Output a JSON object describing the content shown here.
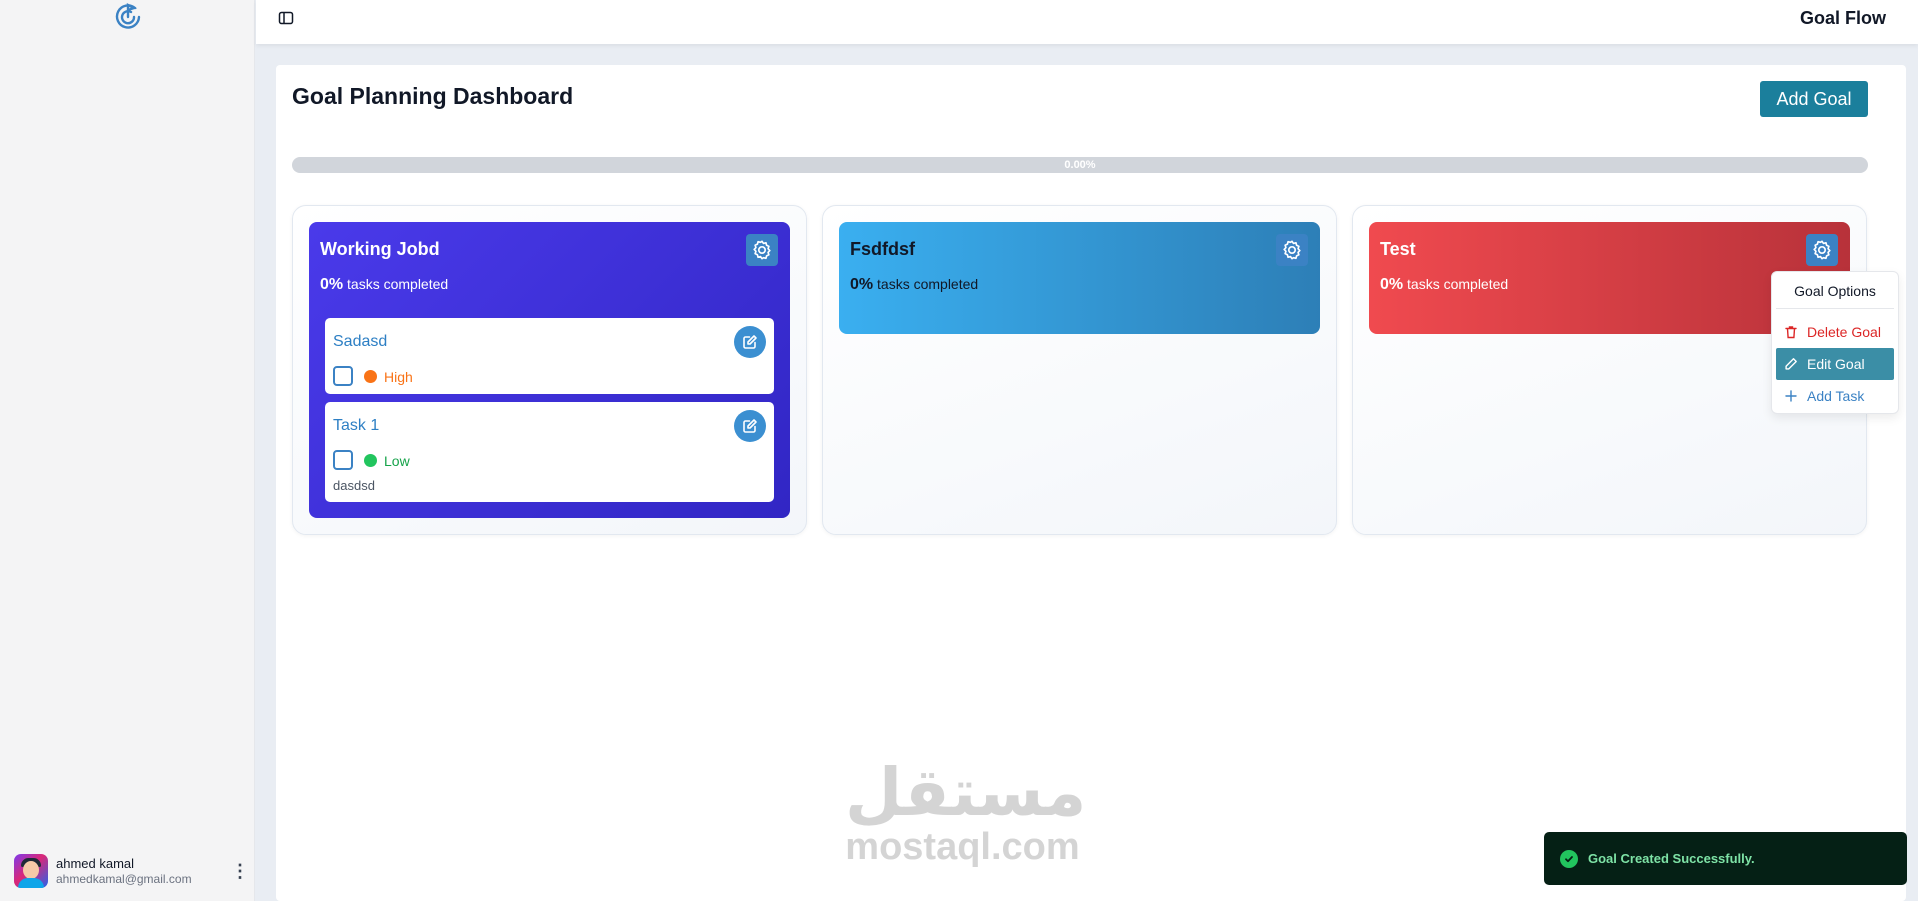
{
  "app": {
    "title": "Goal Flow"
  },
  "sidebar": {
    "user": {
      "name": "ahmed kamal",
      "email": "ahmedkamal@gmail.com"
    }
  },
  "dashboard": {
    "title": "Goal Planning Dashboard",
    "add_goal_label": "Add Goal",
    "progress": 0.0,
    "progress_label": "0.00%"
  },
  "goals": [
    {
      "title": "Working Jobd",
      "percent": "0%",
      "suffix": "tasks completed",
      "tasks": [
        {
          "title": "Sadasd",
          "priority": "High",
          "priority_color": "#f97316",
          "description": ""
        },
        {
          "title": "Task 1",
          "priority": "Low",
          "priority_color": "#22c55e",
          "description": "dasdsd"
        }
      ]
    },
    {
      "title": "Fsdfdsf",
      "percent": "0%",
      "suffix": "tasks completed",
      "tasks": []
    },
    {
      "title": "Test",
      "percent": "0%",
      "suffix": "tasks completed",
      "tasks": []
    }
  ],
  "goal_menu": {
    "title": "Goal Options",
    "delete": "Delete Goal",
    "edit": "Edit Goal",
    "add_task": "Add Task"
  },
  "toast": {
    "message": "Goal Created Successfully."
  },
  "watermark": {
    "arabic": "مستقل",
    "latin": "mostaql.com"
  },
  "colors": {
    "accent": "#1b7f9c",
    "goal1": "#4338ca",
    "goal2": "#3aaff0",
    "goal3": "#ef4444",
    "danger": "#dc2626"
  }
}
